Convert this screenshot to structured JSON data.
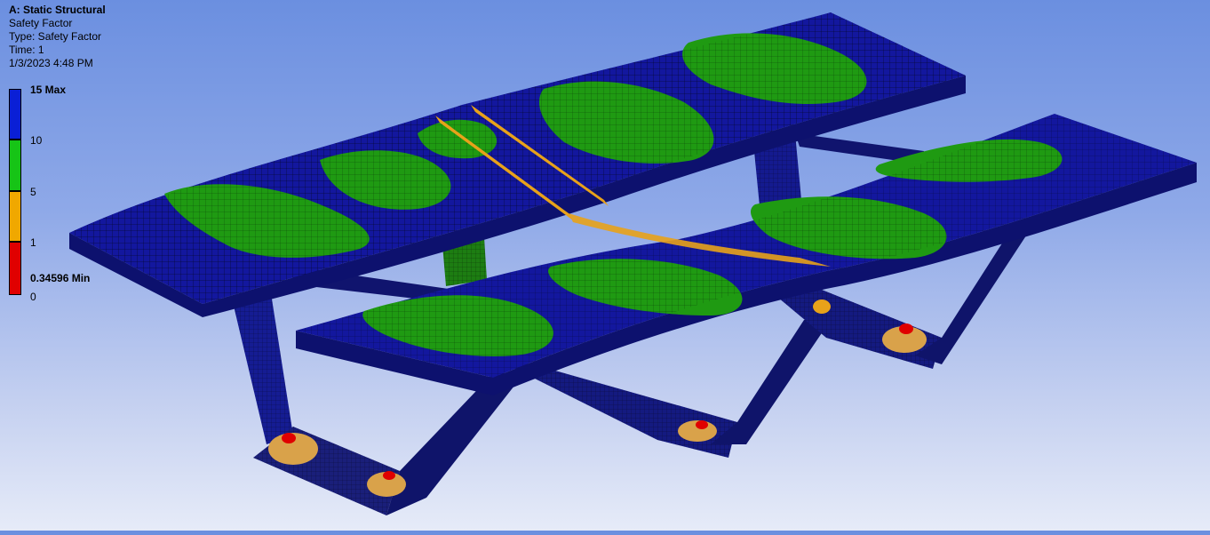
{
  "info": {
    "title": "A: Static Structural",
    "result": "Safety Factor",
    "type": "Type: Safety Factor",
    "time": "Time: 1",
    "date": "1/3/2023 4:48 PM"
  },
  "legend": {
    "levels": [
      {
        "label": "15 Max",
        "color": "#0a1fd6",
        "bold": true
      },
      {
        "label": "10",
        "color": "#16c416"
      },
      {
        "label": "5",
        "color": "#f0a800"
      },
      {
        "label": "1",
        "color": "#e00000"
      },
      {
        "label": "0.34596 Min",
        "color": "#e00000",
        "bold": true
      },
      {
        "label": "0",
        "color": "#e00000"
      }
    ]
  },
  "colors": {
    "safe": "#13179e",
    "mid": "#1f9a12",
    "low": "#e8a21a",
    "critical": "#e00000"
  }
}
